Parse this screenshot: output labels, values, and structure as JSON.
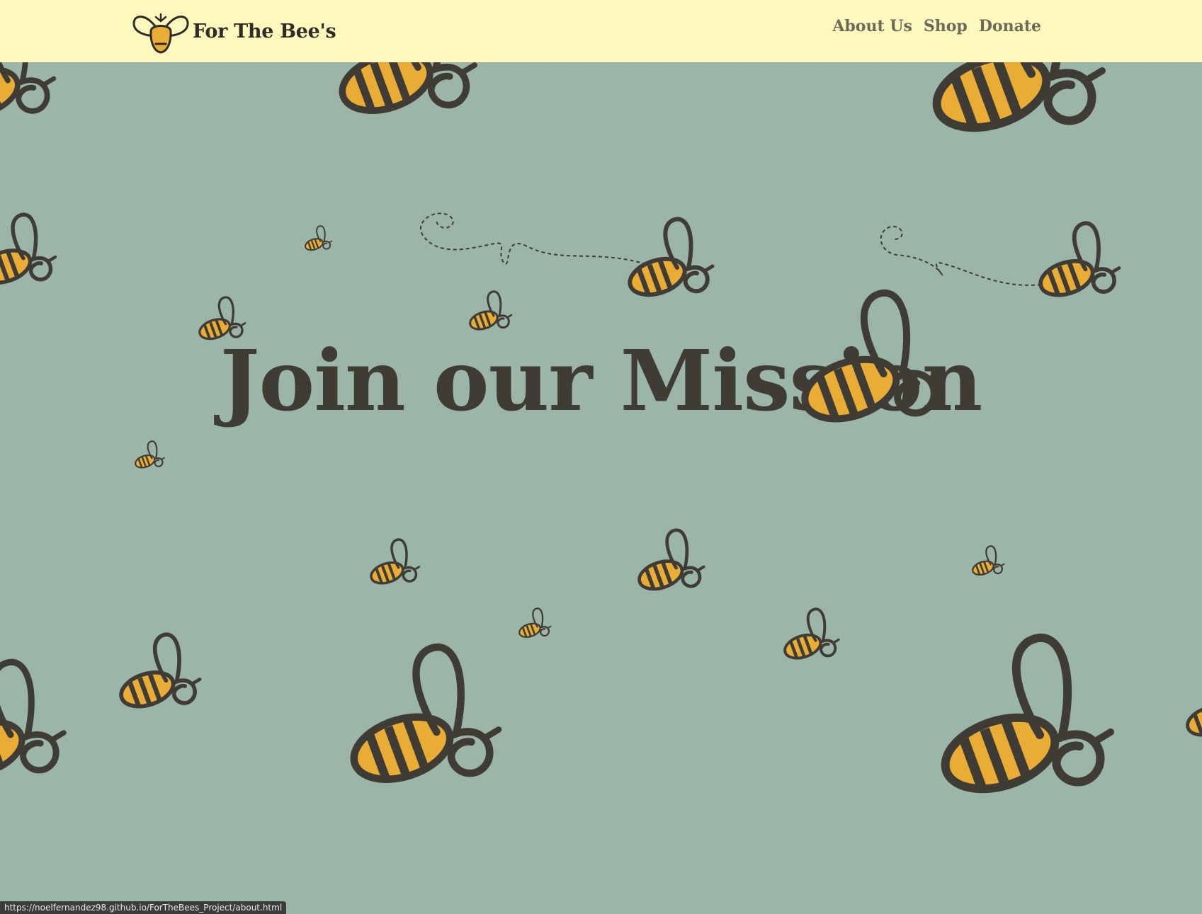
{
  "brand": {
    "name": "For The Bee's",
    "logo_icon": "bee-logo-icon"
  },
  "nav": {
    "links": [
      {
        "label": "About Us"
      },
      {
        "label": "Shop"
      },
      {
        "label": "Donate"
      }
    ]
  },
  "hero": {
    "title": "Join our Mission"
  },
  "status_bar": {
    "url": "https://noelfernandez98.github.io/ForTheBees_Project/about.html"
  },
  "colors": {
    "navbar_bg": "#fdf8bb",
    "page_bg": "#9bb5a6",
    "bee_body": "#e9ad36",
    "outline": "#3f3c36",
    "title_text": "#3f3c36"
  }
}
